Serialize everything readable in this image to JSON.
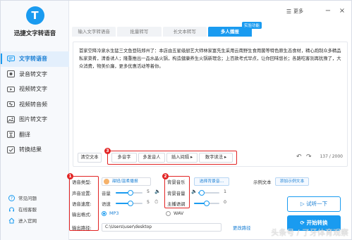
{
  "app": {
    "name": "迅捷文字转语音",
    "logo_letter": "T"
  },
  "sidebar": {
    "items": [
      {
        "label": "文字转语音",
        "icon": "speech-icon",
        "active": true
      },
      {
        "label": "录音转文字",
        "icon": "recorder-icon",
        "active": false
      },
      {
        "label": "视频转文字",
        "icon": "video-icon",
        "active": false
      },
      {
        "label": "视频转音频",
        "icon": "video-audio-icon",
        "active": false
      },
      {
        "label": "图片转文字",
        "icon": "image-icon",
        "active": false
      },
      {
        "label": "翻译",
        "icon": "translate-icon",
        "active": false
      },
      {
        "label": "转换结果",
        "icon": "result-icon",
        "active": false
      }
    ],
    "bottom_links": [
      {
        "label": "常见问题",
        "icon": "question-icon"
      },
      {
        "label": "在线客服",
        "icon": "service-icon"
      },
      {
        "label": "进入官网",
        "icon": "home-icon"
      }
    ]
  },
  "titlebar": {
    "more_label": "更多",
    "minimize": "−",
    "close": "×"
  },
  "tabs": [
    {
      "label": "输入文字转语音",
      "active": false
    },
    {
      "label": "批量转写",
      "active": false
    },
    {
      "label": "长文本转写",
      "active": false
    },
    {
      "label": "多人播报",
      "active": true
    }
  ],
  "badge": "实验功能",
  "editor": {
    "text": "首家空降冷泉水生猛三文鱼登陆郑州了：本店由五星级厨艺大师林家富先生采用云南野生食用菌等特色原生态食材，精心炮制众多精品私家菜肴，清香诱人；隆重推出一品水晶火锅，构造健康养生火锅新理念；上百款考式早点，让你回味悠长；各路吃客别再犹豫了，大众消费，物美价廉，更多优惠活动等着你。",
    "clear_label": "清空文本",
    "multi_voice": "多音字",
    "multi_speaker": "多发音人",
    "insert_pause": "插入间隔",
    "number_read": "数字读法",
    "char_count": "137 / 2000"
  },
  "settings": {
    "voice_type_label": "语音类型:",
    "voice_chip": "甜妞/温柔播报",
    "voice_setting_label": "声音设置:",
    "volume_label": "音量",
    "volume_value": "5",
    "volume_level": 0.55,
    "speed_label": "语音速度:",
    "speed_sub": "语速",
    "speed_value": "5",
    "speed_level": 0.55,
    "format_label": "输出格式:",
    "format_options": [
      "MP3",
      "WAV"
    ],
    "format_selected": "MP3",
    "path_label": "输出路径:",
    "path_value": "C:\\Users\\user\\desktop",
    "change_path": "更改路径",
    "bg_music_label": "背景音乐",
    "bg_music_choice": "选择背景音...",
    "bg_volume_label": "背景音量",
    "bg_volume_value": "1",
    "bg_volume_level": 0.15,
    "main_volume_label": "主播语调",
    "main_volume_value": "0",
    "main_volume_level": 0.5,
    "example_label": "示例文本",
    "add_example": "添加示例文本"
  },
  "actions": {
    "preview": "试听一下",
    "convert": "开始转换"
  },
  "watermark": "头条号 / 了牙体育观察",
  "colors": {
    "accent": "#1a9bf0",
    "highlight": "#e22424"
  },
  "callouts": [
    "1",
    "2",
    "3"
  ]
}
